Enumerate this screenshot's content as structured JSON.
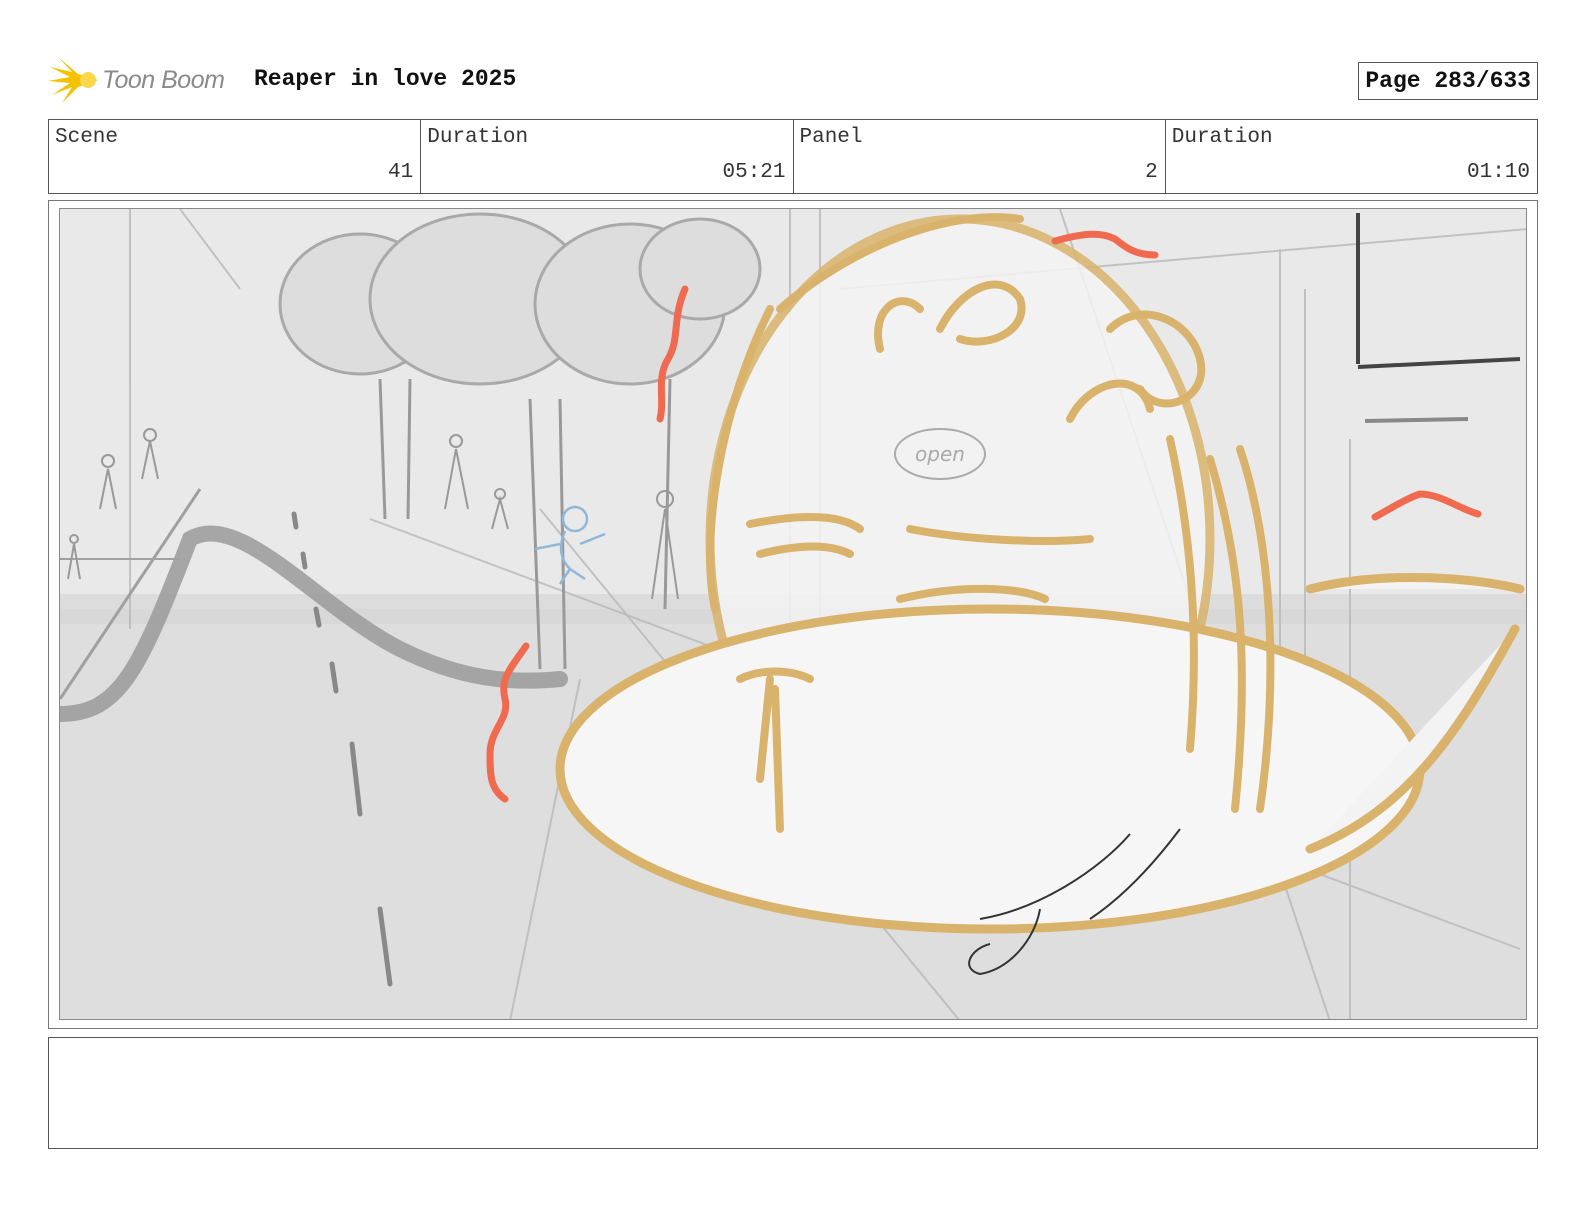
{
  "header": {
    "logo_text": "Toon Boom",
    "logo_icon": "toon-boom-star-icon",
    "project_title": "Reaper in love 2025",
    "page_label": "Page 283/633"
  },
  "info": {
    "scene_label": "Scene",
    "scene_value": "41",
    "scene_duration_label": "Duration",
    "scene_duration_value": "05:21",
    "panel_label": "Panel",
    "panel_value": "2",
    "panel_duration_label": "Duration",
    "panel_duration_value": "01:10"
  },
  "panel": {
    "image": "storyboard-sketch-street-scene",
    "sketch_text": "open"
  },
  "notes": {
    "text": ""
  },
  "colors": {
    "logo_star": "#f5c200",
    "logo_text": "#8a8a8a",
    "sketch_gray": "#9a9a9a",
    "sketch_orange": "#d9b36c",
    "sketch_red": "#f06a4f",
    "sketch_blue": "#8fb8d8",
    "border": "#555555"
  }
}
